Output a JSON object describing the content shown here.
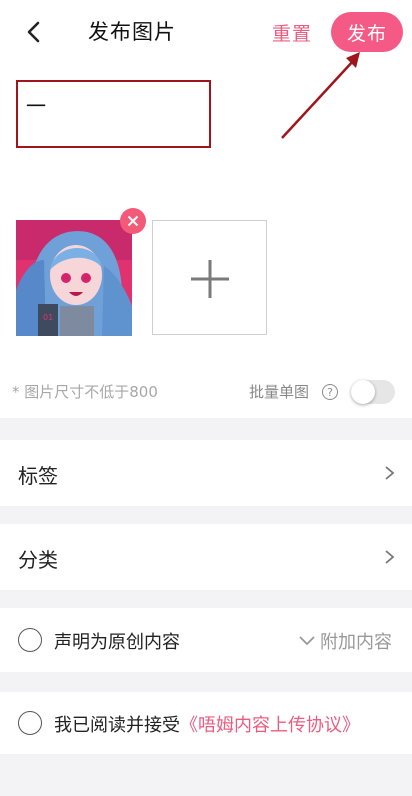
{
  "header": {
    "title": "发布图片",
    "reset_label": "重置",
    "publish_label": "发布"
  },
  "editor": {
    "title_input_value": "一"
  },
  "images": {
    "hint": "* 图片尺寸不低于800",
    "batch_label": "批量单图",
    "help_symbol": "?",
    "batch_toggle_on": false
  },
  "rows": {
    "tags_label": "标签",
    "category_label": "分类"
  },
  "original": {
    "label": "声明为原创内容",
    "extra_label": "附加内容"
  },
  "agreement": {
    "prefix": "我已阅读并接受",
    "link": "《唔姆内容上传协议》"
  },
  "colors": {
    "accent": "#f45a85",
    "annotation": "#a1141c"
  }
}
